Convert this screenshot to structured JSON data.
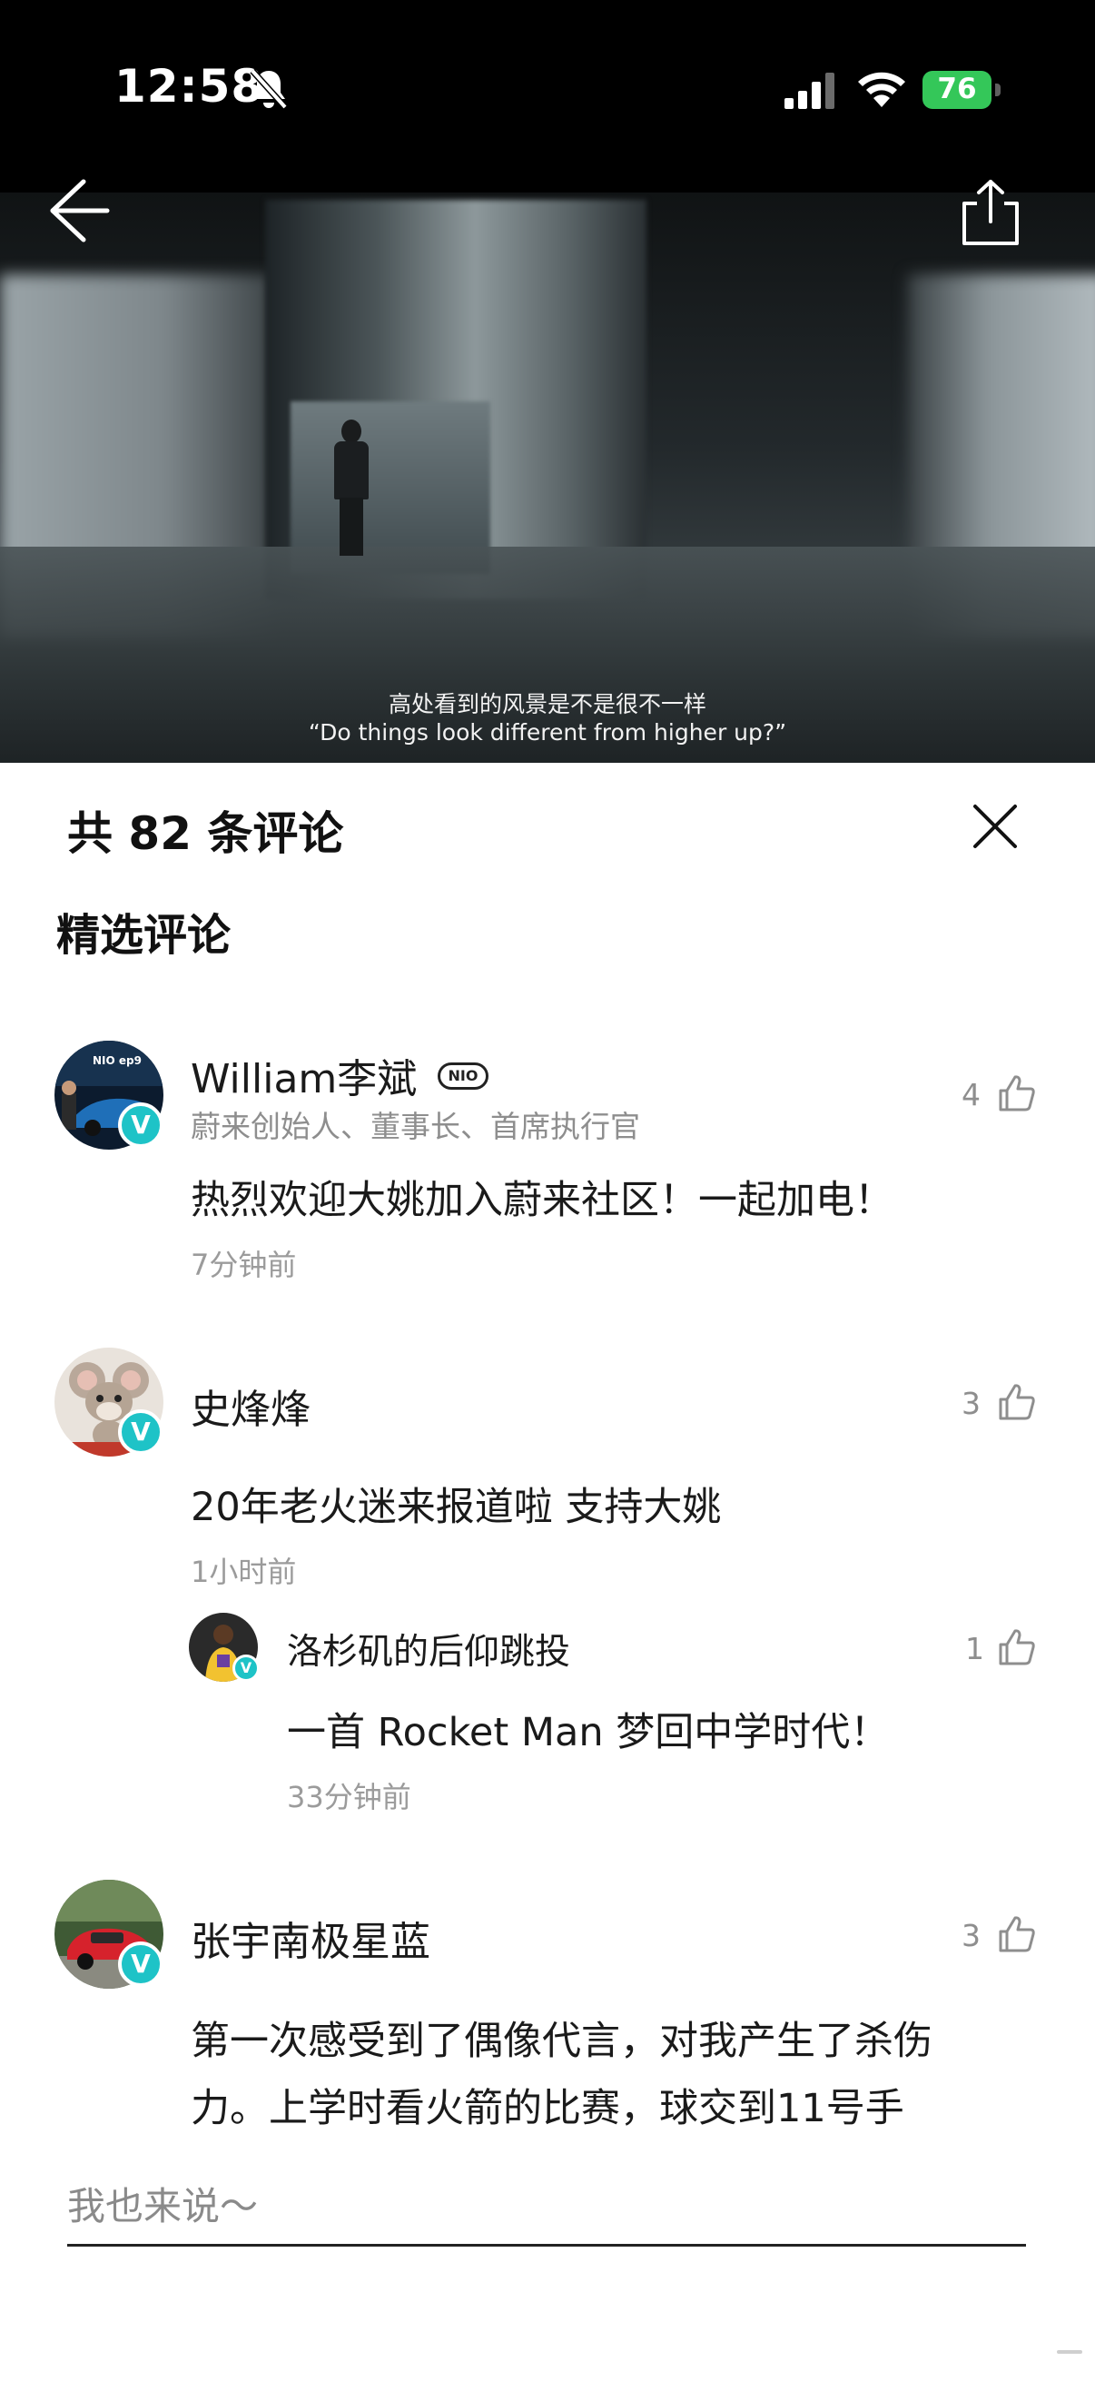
{
  "status_bar": {
    "time": "12:58",
    "battery": "76",
    "silent": true,
    "accent_battery": "#34c759"
  },
  "video": {
    "caption_cn": "高处看到的风景是不是很不一样",
    "caption_en": "“Do things look different from higher up?”"
  },
  "comments_panel": {
    "title": "共 82 条评论",
    "section_title": "精选评论",
    "accent_verified": "#1ec3c7",
    "comments": [
      {
        "username": "William李斌",
        "user_badge": "NIO",
        "subtitle": "蔚来创始人、董事长、首席执行官",
        "text": "热烈欢迎大姚加入蔚来社区！一起加电！",
        "time": "7分钟前",
        "likes": "4",
        "verified": true,
        "avatar_icon": "car-avatar"
      },
      {
        "username": "史烽烽",
        "text": "20年老火迷来报道啦 支持大姚",
        "time": "1小时前",
        "likes": "3",
        "verified": true,
        "avatar_icon": "mouse-cartoon-avatar",
        "replies": [
          {
            "username": "洛杉矶的后仰跳投",
            "text": "一首 Rocket Man 梦回中学时代！",
            "time": "33分钟前",
            "likes": "1",
            "verified": true,
            "avatar_icon": "basketball-player-avatar"
          }
        ]
      },
      {
        "username": "张宇南极星蓝",
        "text_line1": "第一次感受到了偶像代言，对我产生了杀伤",
        "text_line2": "力。上学时看火箭的比赛，球交到11号手",
        "likes": "3",
        "verified": true,
        "avatar_icon": "red-car-avatar"
      }
    ]
  },
  "input": {
    "placeholder": "我也来说～"
  }
}
